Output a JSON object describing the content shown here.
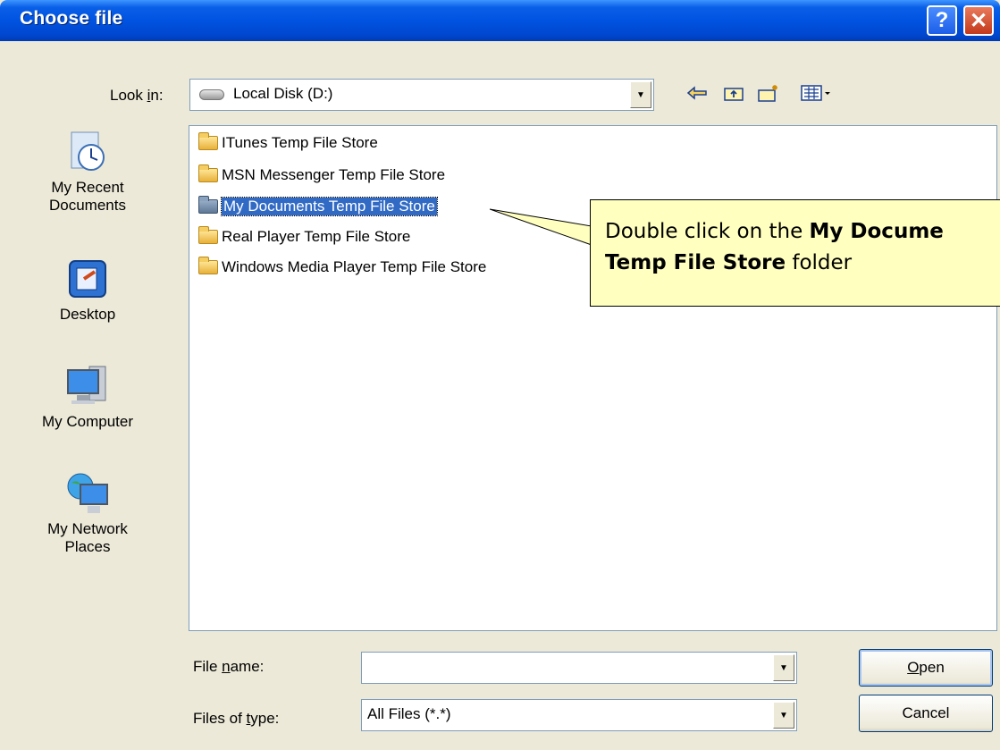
{
  "window": {
    "title": "Choose file",
    "help_btn": "?",
    "close_btn": "✕"
  },
  "look_in": {
    "label_pre": "Look ",
    "label_u": "i",
    "label_post": "n:",
    "value": "Local Disk (D:)"
  },
  "toolbar": {
    "icons": [
      "back-arrow-icon",
      "up-folder-icon",
      "new-folder-icon",
      "view-menu-icon"
    ]
  },
  "places": [
    {
      "label": "My Recent Documents",
      "line1": "My Recent",
      "line2": "Documents",
      "icon": "recent-documents-icon"
    },
    {
      "label": "Desktop",
      "line1": "Desktop",
      "line2": "",
      "icon": "desktop-icon"
    },
    {
      "label": "My Computer",
      "line1": "My Computer",
      "line2": "",
      "icon": "computer-icon"
    },
    {
      "label": "My Network Places",
      "line1": "My Network",
      "line2": "Places",
      "icon": "network-icon"
    }
  ],
  "files": [
    {
      "name": "ITunes Temp File Store",
      "selected": false
    },
    {
      "name": "MSN Messenger Temp File Store",
      "selected": false
    },
    {
      "name": "My Documents Temp File Store",
      "selected": true
    },
    {
      "name": "Real Player Temp File Store",
      "selected": false
    },
    {
      "name": "Windows Media Player Temp File Store",
      "selected": false
    }
  ],
  "callout": {
    "pre": "Double click on the ",
    "bold1": "My Docume",
    "bold2": "Temp File Store",
    "post": " folder"
  },
  "file_name": {
    "label_pre": "File ",
    "label_u": "n",
    "label_post": "ame:",
    "value": ""
  },
  "file_type": {
    "label_pre": "Files of ",
    "label_u": "t",
    "label_post": "ype:",
    "value": "All Files (*.*)"
  },
  "buttons": {
    "open_u": "O",
    "open_rest": "pen",
    "cancel": "Cancel"
  }
}
